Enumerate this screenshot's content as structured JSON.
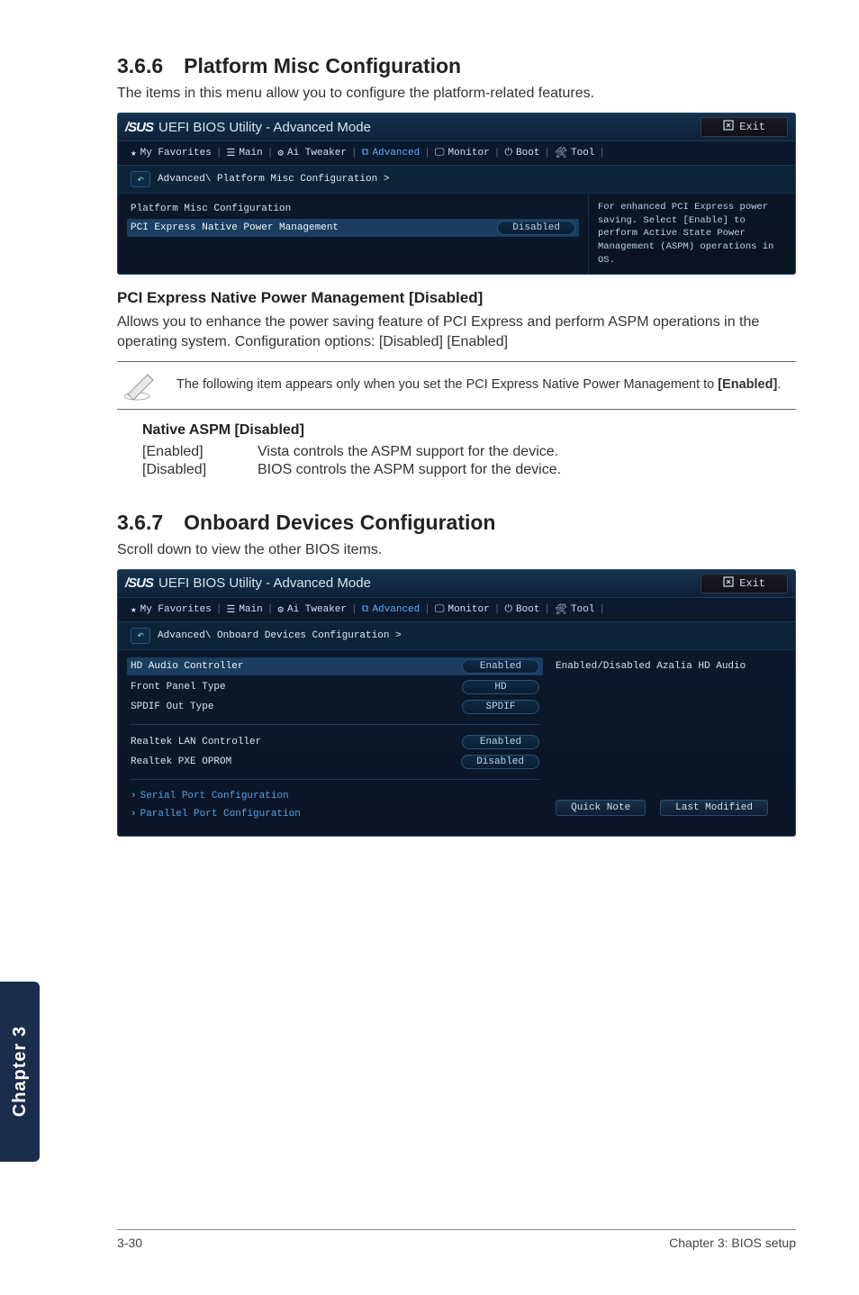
{
  "section366": {
    "number_title": "3.6.6 Platform Misc Configuration",
    "intro": "The items in this menu allow you to configure the platform-related features."
  },
  "bios1": {
    "brand": "/SUS",
    "title": "UEFI BIOS Utility - Advanced Mode",
    "exit_label": "Exit",
    "tabs": {
      "favorites": "My Favorites",
      "main": "Main",
      "ai_tweaker": "Ai Tweaker",
      "advanced": "Advanced",
      "monitor": "Monitor",
      "boot": "Boot",
      "tool": "Tool"
    },
    "breadcrumb": "Advanced\\ Platform Misc Configuration >",
    "heading": "Platform Misc Configuration",
    "row1_label": "PCI Express Native Power Management",
    "row1_value": "Disabled",
    "help": "For enhanced PCI Express power saving. Select [Enable] to perform Active State Power Management (ASPM) operations in OS."
  },
  "pci_heading": "PCI Express Native Power Management [Disabled]",
  "pci_para": "Allows you to enhance the power saving feature of PCI Express and perform ASPM operations in the operating system. Configuration options: [Disabled] [Enabled]",
  "note": {
    "text_prefix": "The following item appears only when you set the PCI Express Native Power Management to ",
    "text_bold": "[Enabled]",
    "text_suffix": "."
  },
  "native_aspm": {
    "heading": "Native ASPM [Disabled]",
    "enabled_key": "[Enabled]",
    "enabled_desc": "Vista controls the ASPM support for the device.",
    "disabled_key": "[Disabled]",
    "disabled_desc": "BIOS controls the ASPM support for the device."
  },
  "section367": {
    "number_title": "3.6.7 Onboard Devices Configuration",
    "intro": "Scroll down to view the other BIOS items."
  },
  "bios2": {
    "brand": "/SUS",
    "title": "UEFI BIOS Utility - Advanced Mode",
    "exit_label": "Exit",
    "tabs": {
      "favorites": "My Favorites",
      "main": "Main",
      "ai_tweaker": "Ai Tweaker",
      "advanced": "Advanced",
      "monitor": "Monitor",
      "boot": "Boot",
      "tool": "Tool"
    },
    "breadcrumb": "Advanced\\ Onboard Devices Configuration >",
    "rows": {
      "hd_audio_label": "HD Audio Controller",
      "hd_audio_value": "Enabled",
      "front_panel_label": "Front Panel Type",
      "front_panel_value": "HD",
      "spdif_label": "SPDIF Out Type",
      "spdif_value": "SPDIF",
      "lan_label": "Realtek LAN Controller",
      "lan_value": "Enabled",
      "pxe_label": "Realtek PXE OPROM",
      "pxe_value": "Disabled",
      "serial_link": "Serial Port Configuration",
      "parallel_link": "Parallel Port Configuration"
    },
    "help": "Enabled/Disabled Azalia HD Audio",
    "quick_note": "Quick Note",
    "last_modified": "Last Modified"
  },
  "chapter_tab": "Chapter 3",
  "footer": {
    "left": "3-30",
    "right": "Chapter 3: BIOS setup"
  }
}
